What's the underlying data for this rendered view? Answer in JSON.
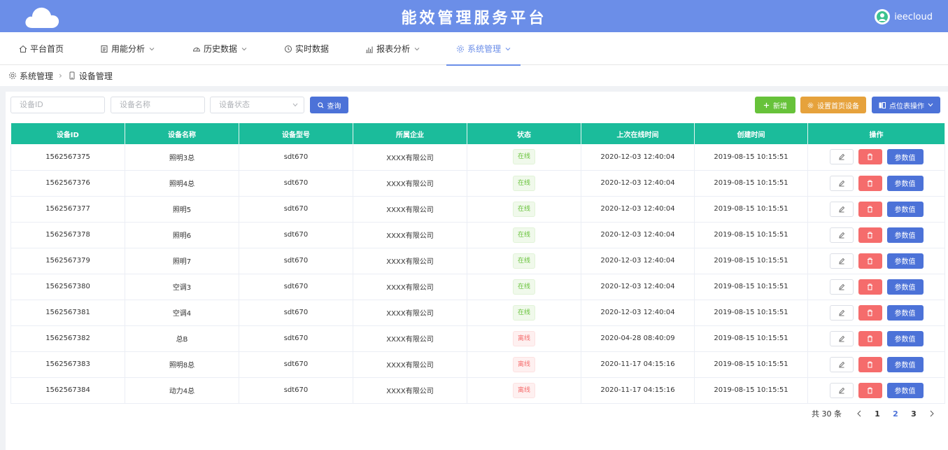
{
  "app": {
    "title": "能效管理服务平台",
    "user": "ieecloud"
  },
  "nav": [
    {
      "label": "平台首页",
      "icon": "home-icon",
      "dropdown": false,
      "active": false
    },
    {
      "label": "用能分析",
      "icon": "document-icon",
      "dropdown": true,
      "active": false
    },
    {
      "label": "历史数据",
      "icon": "dashboard-icon",
      "dropdown": true,
      "active": false
    },
    {
      "label": "实时数据",
      "icon": "clock-icon",
      "dropdown": false,
      "active": false
    },
    {
      "label": "报表分析",
      "icon": "bar-chart-icon",
      "dropdown": true,
      "active": false
    },
    {
      "label": "系统管理",
      "icon": "gear-icon",
      "dropdown": true,
      "active": true
    }
  ],
  "breadcrumb": {
    "parent": "系统管理",
    "current": "设备管理"
  },
  "filters": {
    "device_id_placeholder": "设备ID",
    "device_name_placeholder": "设备名称",
    "status_placeholder": "设备状态",
    "query_label": "查询"
  },
  "actions": {
    "add_label": "新增",
    "homepage_device_label": "设置首页设备",
    "point_table_label": "点位表操作"
  },
  "colors": {
    "header_blue": "#6b8ee8",
    "table_header": "#1bbc9b",
    "add_green": "#67c23a",
    "homepage_orange": "#e6a23c",
    "primary_blue": "#4c72d8",
    "delete_red": "#f56c6c"
  },
  "table": {
    "columns": [
      "设备ID",
      "设备名称",
      "设备型号",
      "所属企业",
      "状态",
      "上次在线时间",
      "创建时间",
      "操作"
    ],
    "param_label": "参数值",
    "rows": [
      {
        "id": "1562567375",
        "name": "照明3总",
        "model": "sdt670",
        "company": "XXXX有限公司",
        "status": "在线",
        "online": true,
        "last_online": "2020-12-03 12:40:04",
        "created": "2019-08-15 10:15:51"
      },
      {
        "id": "1562567376",
        "name": "照明4总",
        "model": "sdt670",
        "company": "XXXX有限公司",
        "status": "在线",
        "online": true,
        "last_online": "2020-12-03 12:40:04",
        "created": "2019-08-15 10:15:51"
      },
      {
        "id": "1562567377",
        "name": "照明5",
        "model": "sdt670",
        "company": "XXXX有限公司",
        "status": "在线",
        "online": true,
        "last_online": "2020-12-03 12:40:04",
        "created": "2019-08-15 10:15:51"
      },
      {
        "id": "1562567378",
        "name": "照明6",
        "model": "sdt670",
        "company": "XXXX有限公司",
        "status": "在线",
        "online": true,
        "last_online": "2020-12-03 12:40:04",
        "created": "2019-08-15 10:15:51"
      },
      {
        "id": "1562567379",
        "name": "照明7",
        "model": "sdt670",
        "company": "XXXX有限公司",
        "status": "在线",
        "online": true,
        "last_online": "2020-12-03 12:40:04",
        "created": "2019-08-15 10:15:51"
      },
      {
        "id": "1562567380",
        "name": "空调3",
        "model": "sdt670",
        "company": "XXXX有限公司",
        "status": "在线",
        "online": true,
        "last_online": "2020-12-03 12:40:04",
        "created": "2019-08-15 10:15:51"
      },
      {
        "id": "1562567381",
        "name": "空调4",
        "model": "sdt670",
        "company": "XXXX有限公司",
        "status": "在线",
        "online": true,
        "last_online": "2020-12-03 12:40:04",
        "created": "2019-08-15 10:15:51"
      },
      {
        "id": "1562567382",
        "name": "总B",
        "model": "sdt670",
        "company": "XXXX有限公司",
        "status": "离线",
        "online": false,
        "last_online": "2020-04-28 08:40:09",
        "created": "2019-08-15 10:15:51"
      },
      {
        "id": "1562567383",
        "name": "照明8总",
        "model": "sdt670",
        "company": "XXXX有限公司",
        "status": "离线",
        "online": false,
        "last_online": "2020-11-17 04:15:16",
        "created": "2019-08-15 10:15:51"
      },
      {
        "id": "1562567384",
        "name": "动力4总",
        "model": "sdt670",
        "company": "XXXX有限公司",
        "status": "离线",
        "online": false,
        "last_online": "2020-11-17 04:15:16",
        "created": "2019-08-15 10:15:51"
      }
    ]
  },
  "pagination": {
    "total_label": "共 30 条",
    "pages": [
      "1",
      "2",
      "3"
    ],
    "current": "2"
  }
}
